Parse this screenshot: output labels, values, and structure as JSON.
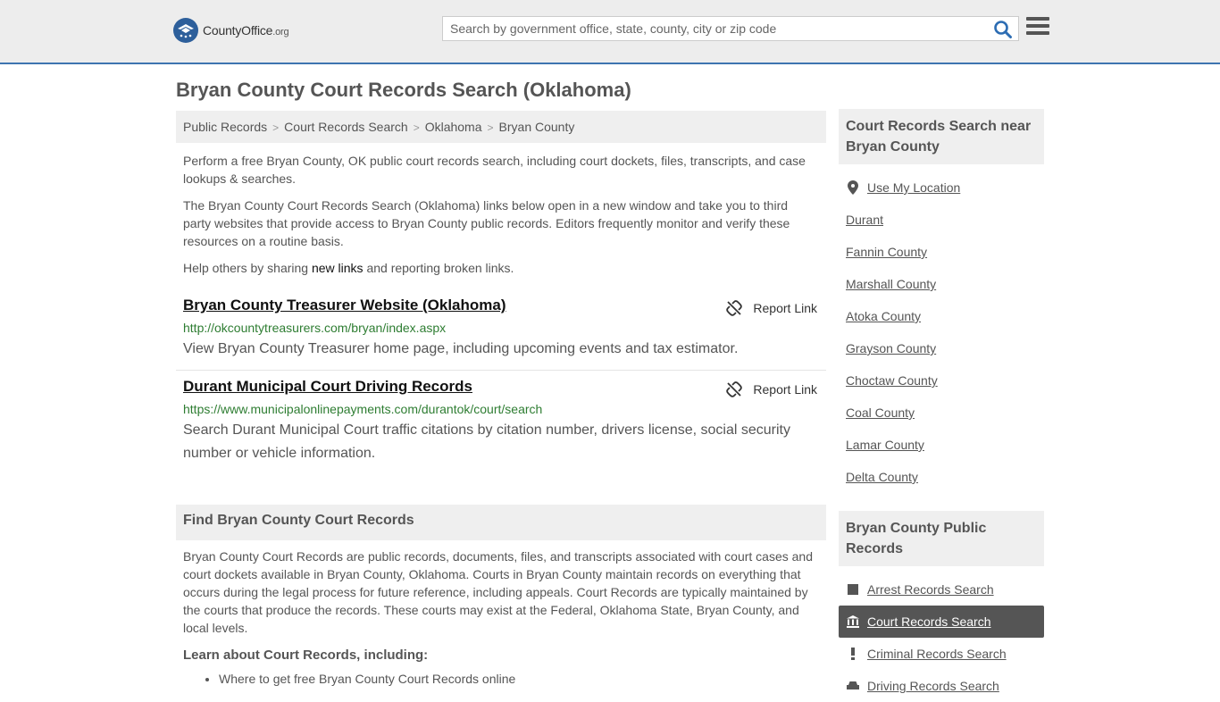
{
  "header": {
    "logo_main": "CountyOffice",
    "logo_suffix": ".org",
    "search_placeholder": "Search by government office, state, county, city or zip code"
  },
  "page_title": "Bryan County Court Records Search (Oklahoma)",
  "breadcrumb": [
    "Public Records",
    "Court Records Search",
    "Oklahoma",
    "Bryan County"
  ],
  "intro": {
    "p1": "Perform a free Bryan County, OK public court records search, including court dockets, files, transcripts, and case lookups & searches.",
    "p2": "The Bryan County Court Records Search (Oklahoma) links below open in a new window and take you to third party websites that provide access to Bryan County public records. Editors frequently monitor and verify these resources on a routine basis.",
    "p3_before": "Help others by sharing ",
    "p3_link": "new links",
    "p3_after": " and reporting broken links."
  },
  "links": [
    {
      "title": "Bryan County Treasurer Website (Oklahoma)",
      "report": "Report Link",
      "url": "http://okcountytreasurers.com/bryan/index.aspx",
      "desc": "View Bryan County Treasurer home page, including upcoming events and tax estimator."
    },
    {
      "title": "Durant Municipal Court Driving Records",
      "report": "Report Link",
      "url": "https://www.municipalonlinepayments.com/durantok/court/search",
      "desc": "Search Durant Municipal Court traffic citations by citation number, drivers license, social security number or vehicle information."
    }
  ],
  "find_section": {
    "title": "Find Bryan County Court Records",
    "body": "Bryan County Court Records are public records, documents, files, and transcripts associated with court cases and court dockets available in Bryan County, Oklahoma. Courts in Bryan County maintain records on everything that occurs during the legal process for future reference, including appeals. Court Records are typically maintained by the courts that produce the records. These courts may exist at the Federal, Oklahoma State, Bryan County, and local levels.",
    "learn_title": "Learn about Court Records, including:",
    "learn_items": [
      "Where to get free Bryan County Court Records online"
    ]
  },
  "sidebar": {
    "near_title": "Court Records Search near Bryan County",
    "use_location": "Use My Location",
    "near_items": [
      "Durant",
      "Fannin County",
      "Marshall County",
      "Atoka County",
      "Grayson County",
      "Choctaw County",
      "Coal County",
      "Lamar County",
      "Delta County"
    ],
    "public_title": "Bryan County Public Records",
    "public_items": [
      {
        "label": "Arrest Records Search",
        "icon": "square-icon"
      },
      {
        "label": "Court Records Search",
        "icon": "courthouse-icon"
      },
      {
        "label": "Criminal Records Search",
        "icon": "exclamation-icon"
      },
      {
        "label": "Driving Records Search",
        "icon": "car-icon"
      }
    ]
  },
  "colors": {
    "header_bg": "#ededed",
    "header_border": "#3e74b0",
    "url_green": "#2e7d32",
    "search_icon": "#2d6db3",
    "active_bg": "#555555"
  }
}
